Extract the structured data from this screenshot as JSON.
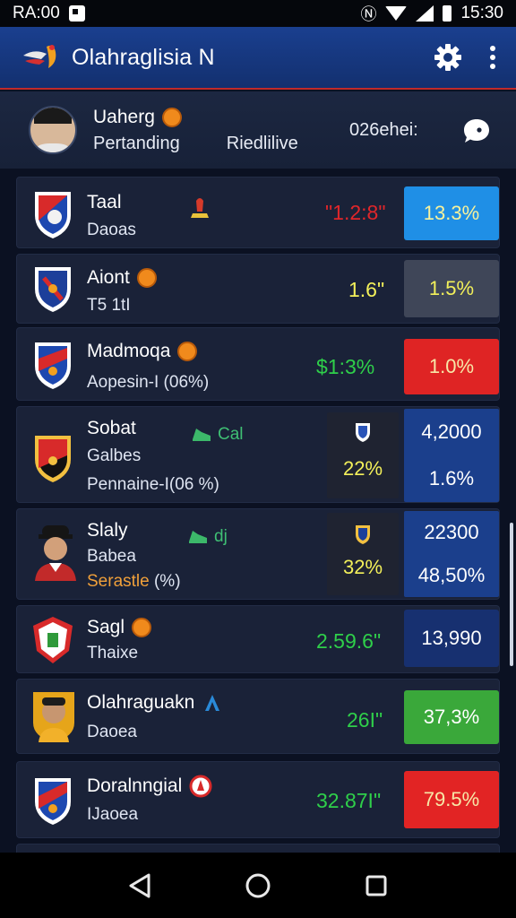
{
  "status": {
    "time_left": "RA:00",
    "time_right": "15:30"
  },
  "app": {
    "title": "Olahraglisia N"
  },
  "profile": {
    "name": "Uaherg",
    "status": "Pertanding",
    "live_label": "Riedlilive",
    "code": "026ehei:"
  },
  "rows": [
    {
      "title": "Taal",
      "sub": "Daoas",
      "stat": "\"1.2:8\"",
      "pct": "13.3%",
      "stat_color": "#e0262a",
      "pct_bg": "#1f8fe6",
      "pct_color": "#f8f29b"
    },
    {
      "title": "Aiont",
      "sub": "T5 1tI",
      "stat": "1.6\"",
      "pct": "1.5%",
      "stat_color": "#f3f05a",
      "pct_bg": "#3f4658",
      "pct_color": "#f3f05a"
    },
    {
      "title": "Madmoqa",
      "sub": "Aopesin-I (06%)",
      "stat": "$1:3%",
      "pct": "1.0%",
      "stat_color": "#2fcf4a",
      "pct_bg": "#df2424",
      "pct_color": "#f7e8a8"
    },
    {
      "title": "Sobat",
      "tag": "Cal",
      "sub": "Galbes",
      "sub2": "Pennaine-I(06 %)",
      "box_value": "22%",
      "top_value": "4,2000",
      "bottom_value": "1.6%"
    },
    {
      "title": "Slaly",
      "tag": "dj",
      "sub": "Babea",
      "sub2": "Serastle",
      "sub2_suffix": "(%)",
      "box_value": "32%",
      "top_value": "22300",
      "bottom_value": "48,50%"
    },
    {
      "title": "Sagl",
      "sub": "Thaixe",
      "stat": "2.59.6\"",
      "pct": "13,990",
      "stat_color": "#2fcf4a",
      "pct_bg": "#173070",
      "pct_color": "#ffffff"
    },
    {
      "title": "Olahraguakn",
      "sub": "Daoea",
      "stat": "26I\"",
      "pct": "37,3%",
      "stat_color": "#2fcf4a",
      "pct_bg": "#3aa83a",
      "pct_color": "#ffffff"
    },
    {
      "title": "Doralnngial",
      "sub": "IJaoea",
      "stat": "32.87I\"",
      "pct": "79.5%",
      "stat_color": "#2fcf4a",
      "pct_bg": "#e22424",
      "pct_color": "#f7e8a8"
    }
  ],
  "icons": {
    "settings": "gear-icon",
    "more": "more-vertical-icon",
    "chat": "chat-bubble-icon",
    "back": "back-triangle-icon",
    "home": "home-circle-icon",
    "recents": "recents-square-icon"
  }
}
